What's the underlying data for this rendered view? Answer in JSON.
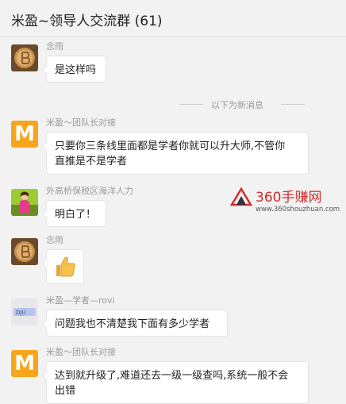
{
  "header": {
    "title": "米盈~领导人交流群 (61)"
  },
  "divider": {
    "text": "以下为新消息"
  },
  "messages": [
    {
      "sender": "念雨",
      "text": "是这样吗"
    },
    {
      "sender": "米盈～团队长对接",
      "line1": "只要你三条线里面都是学者你就可以升大师,不管你",
      "line2": "直推是不是学者"
    },
    {
      "sender": "外高桥保税区海洋人力",
      "text": "明白了！"
    },
    {
      "sender": "念雨",
      "emoji": "thumbs-up"
    },
    {
      "sender": "米盈—学者—rovi",
      "text": "问题我也不清楚我下面有多少学者"
    },
    {
      "sender": "米盈～团队长对接",
      "line1": "达到就升级了,难道还去一级一级查吗,系统一般不会",
      "line2": "出错"
    }
  ],
  "watermark": {
    "brand": "360手赚网",
    "url": "www.360shouzhuan.com"
  },
  "avatar_text": {
    "m": "M",
    "small": "DJU"
  }
}
